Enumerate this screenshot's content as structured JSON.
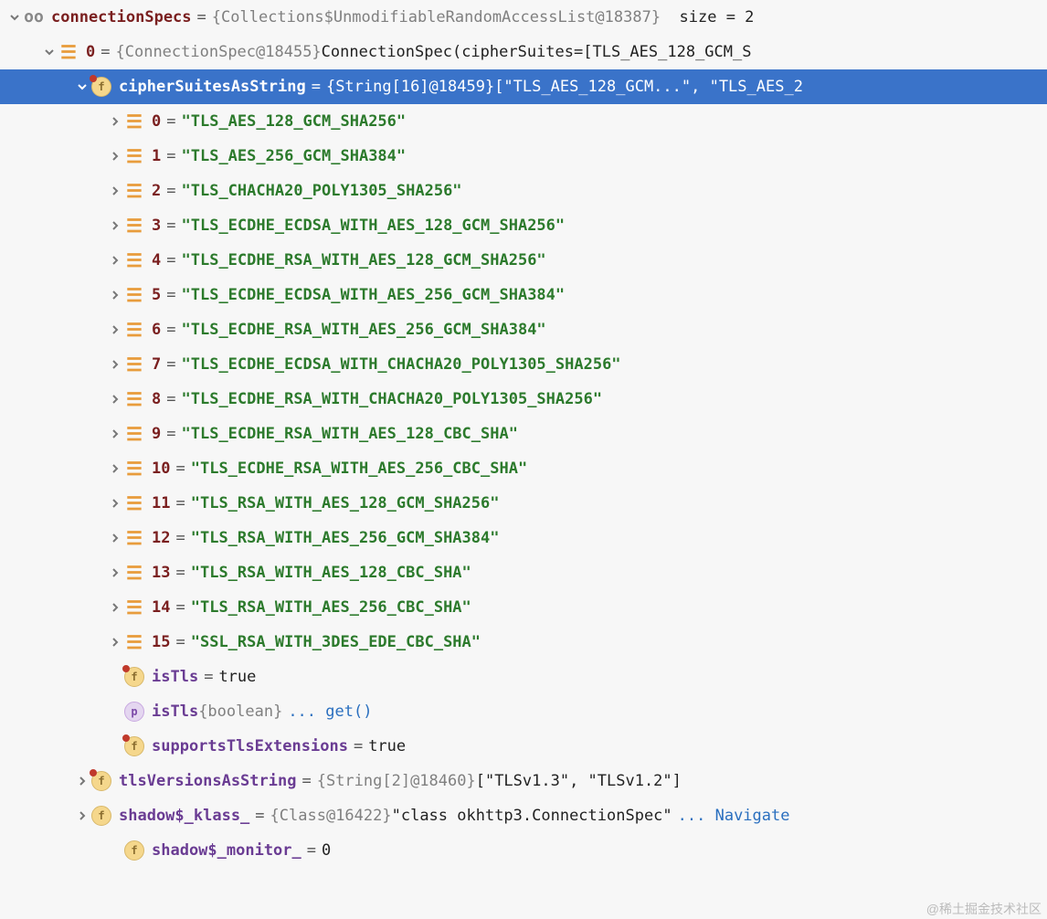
{
  "root": {
    "name": "connectionSpecs",
    "obj": "{Collections$UnmodifiableRandomAccessList@18387}",
    "sizeLabel": "size = 2"
  },
  "item0": {
    "idx": "0",
    "obj": "{ConnectionSpec@18455}",
    "text": "ConnectionSpec(cipherSuites=[TLS_AES_128_GCM_S"
  },
  "cipher": {
    "name": "cipherSuitesAsString",
    "obj": "{String[16]@18459}",
    "preview": "[\"TLS_AES_128_GCM...\", \"TLS_AES_2"
  },
  "suites": [
    {
      "i": "0",
      "v": "\"TLS_AES_128_GCM_SHA256\""
    },
    {
      "i": "1",
      "v": "\"TLS_AES_256_GCM_SHA384\""
    },
    {
      "i": "2",
      "v": "\"TLS_CHACHA20_POLY1305_SHA256\""
    },
    {
      "i": "3",
      "v": "\"TLS_ECDHE_ECDSA_WITH_AES_128_GCM_SHA256\""
    },
    {
      "i": "4",
      "v": "\"TLS_ECDHE_RSA_WITH_AES_128_GCM_SHA256\""
    },
    {
      "i": "5",
      "v": "\"TLS_ECDHE_ECDSA_WITH_AES_256_GCM_SHA384\""
    },
    {
      "i": "6",
      "v": "\"TLS_ECDHE_RSA_WITH_AES_256_GCM_SHA384\""
    },
    {
      "i": "7",
      "v": "\"TLS_ECDHE_ECDSA_WITH_CHACHA20_POLY1305_SHA256\""
    },
    {
      "i": "8",
      "v": "\"TLS_ECDHE_RSA_WITH_CHACHA20_POLY1305_SHA256\""
    },
    {
      "i": "9",
      "v": "\"TLS_ECDHE_RSA_WITH_AES_128_CBC_SHA\""
    },
    {
      "i": "10",
      "v": "\"TLS_ECDHE_RSA_WITH_AES_256_CBC_SHA\""
    },
    {
      "i": "11",
      "v": "\"TLS_RSA_WITH_AES_128_GCM_SHA256\""
    },
    {
      "i": "12",
      "v": "\"TLS_RSA_WITH_AES_256_GCM_SHA384\""
    },
    {
      "i": "13",
      "v": "\"TLS_RSA_WITH_AES_128_CBC_SHA\""
    },
    {
      "i": "14",
      "v": "\"TLS_RSA_WITH_AES_256_CBC_SHA\""
    },
    {
      "i": "15",
      "v": "\"SSL_RSA_WITH_3DES_EDE_CBC_SHA\""
    }
  ],
  "isTlsField": {
    "name": "isTls",
    "val": "true"
  },
  "isTlsProp": {
    "name": "isTls",
    "type": "{boolean}",
    "link": "... get()"
  },
  "supports": {
    "name": "supportsTlsExtensions",
    "val": "true"
  },
  "tlsVer": {
    "name": "tlsVersionsAsString",
    "obj": "{String[2]@18460}",
    "preview": "[\"TLSv1.3\", \"TLSv1.2\"]"
  },
  "klass": {
    "name": "shadow$_klass_",
    "obj": "{Class@16422}",
    "val": "\"class okhttp3.ConnectionSpec\"",
    "link": "... Navigate"
  },
  "monitor": {
    "name": "shadow$_monitor_",
    "val": "0"
  },
  "watermark": "@稀土掘金技术社区"
}
